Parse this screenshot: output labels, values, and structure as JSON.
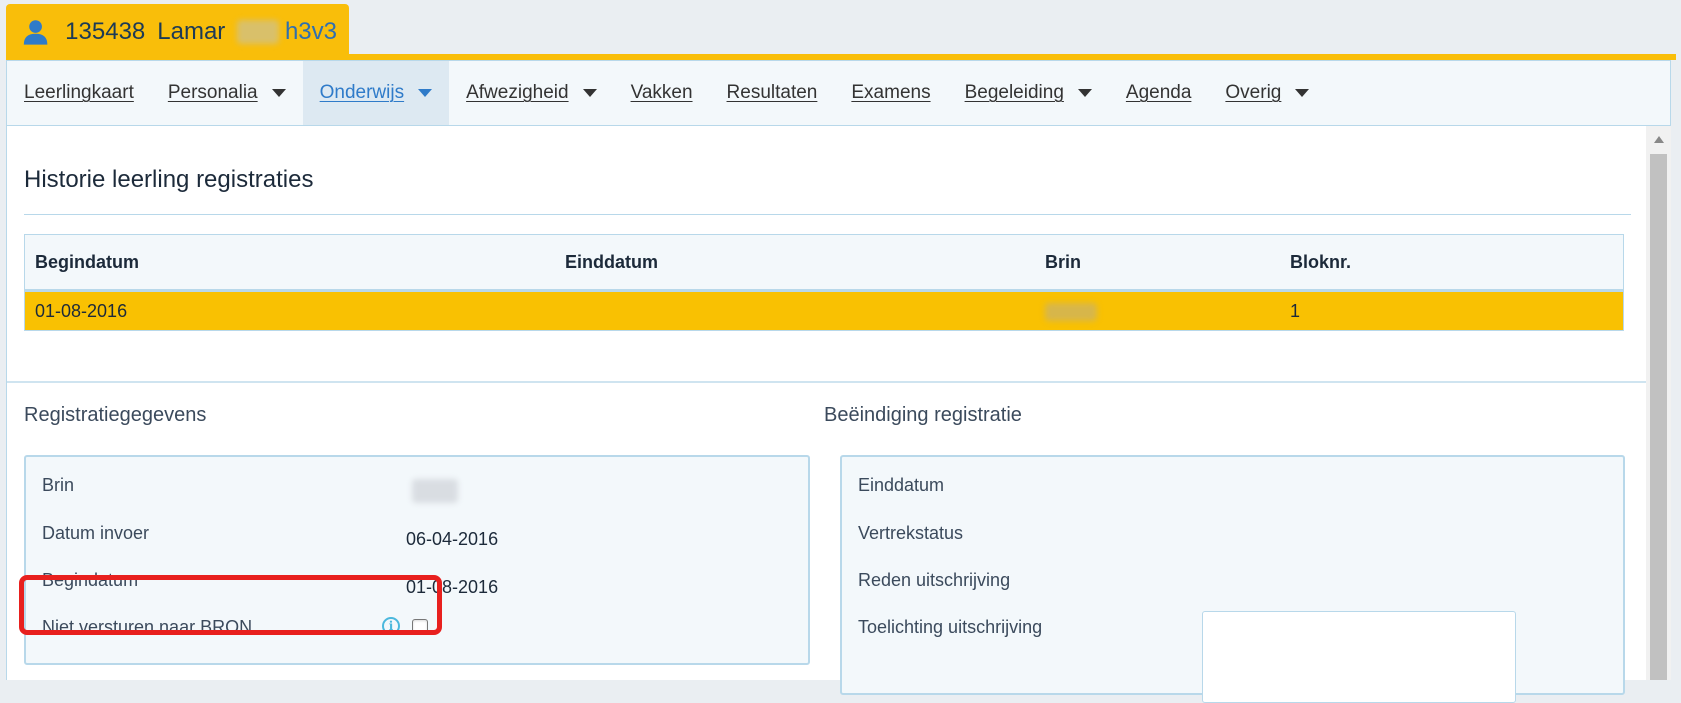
{
  "student": {
    "id": "135438",
    "first_name": "Lamar",
    "class_code": "h3v3"
  },
  "nav": {
    "items": [
      {
        "label": "Leerlingkaart",
        "dropdown": false
      },
      {
        "label": "Personalia",
        "dropdown": true
      },
      {
        "label": "Onderwijs",
        "dropdown": true,
        "active": true
      },
      {
        "label": "Afwezigheid",
        "dropdown": true
      },
      {
        "label": "Vakken",
        "dropdown": false
      },
      {
        "label": "Resultaten",
        "dropdown": false
      },
      {
        "label": "Examens",
        "dropdown": false
      },
      {
        "label": "Begeleiding",
        "dropdown": true
      },
      {
        "label": "Agenda",
        "dropdown": false
      },
      {
        "label": "Overig",
        "dropdown": true
      }
    ]
  },
  "page": {
    "title": "Historie leerling registraties"
  },
  "history_table": {
    "columns": [
      "Begindatum",
      "Einddatum",
      "Brin",
      "Bloknr."
    ],
    "rows": [
      {
        "begindatum": "01-08-2016",
        "einddatum": "",
        "bloknr": "1"
      }
    ]
  },
  "registration": {
    "title": "Registratiegegevens",
    "brin_label": "Brin",
    "datum_invoer_label": "Datum invoer",
    "datum_invoer_value": "06-04-2016",
    "begindatum_label": "Begindatum",
    "begindatum_value": "01-08-2016",
    "niet_versturen_label": "Niet versturen naar BRON",
    "niet_versturen_checked": false
  },
  "ending": {
    "title": "Beëindiging registratie",
    "einddatum_label": "Einddatum",
    "vertrekstatus_label": "Vertrekstatus",
    "reden_label": "Reden uitschrijving",
    "toelichting_label": "Toelichting uitschrijving"
  },
  "colors": {
    "accent_yellow": "#f9be0a",
    "highlight_red": "#e8201e",
    "active_blue": "#2f7bc9"
  }
}
